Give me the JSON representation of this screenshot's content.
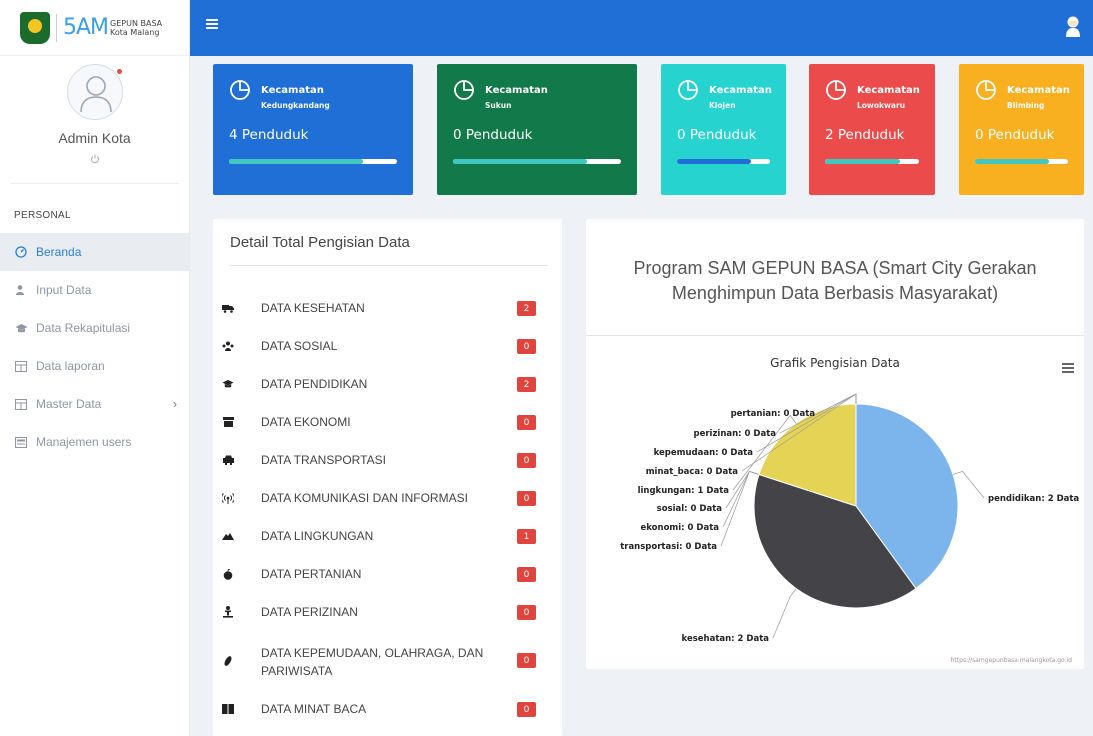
{
  "brand": {
    "logo_text": "5AM",
    "line1": "GEPUN BASA",
    "line2": "Kota Malang"
  },
  "profile": {
    "name": "Admin Kota"
  },
  "nav": {
    "heading": "PERSONAL",
    "items": [
      {
        "label": "Beranda",
        "icon": "dashboard-icon",
        "active": true
      },
      {
        "label": "Input Data",
        "icon": "user-edit-icon"
      },
      {
        "label": "Data Rekapitulasi",
        "icon": "graduation-cap-icon"
      },
      {
        "label": "Data laporan",
        "icon": "table-icon"
      },
      {
        "label": "Master Data",
        "icon": "table-icon"
      },
      {
        "label": "Manajemen users",
        "icon": "users-table-icon"
      }
    ]
  },
  "cards": [
    {
      "title": "Kecamatan",
      "sub": "Kedungkandang",
      "value": "4 Penduduk",
      "bg": "#1f6fd6",
      "fill": "#3fc7c0",
      "progress": 0.8
    },
    {
      "title": "Kecamatan",
      "sub": "Sukun",
      "value": "0 Penduduk",
      "bg": "#127a4a",
      "fill": "#3fc7c0",
      "progress": 0.8
    },
    {
      "title": "Kecamatan",
      "sub": "Klojen",
      "value": "0 Penduduk",
      "bg": "#27d3cf",
      "fill": "#1f6fd6",
      "progress": 0.8
    },
    {
      "title": "Kecamatan",
      "sub": "Lowokwaru",
      "value": "2 Penduduk",
      "bg": "#ec4b4b",
      "fill": "#3fc7c0",
      "progress": 0.8
    },
    {
      "title": "Kecamatan",
      "sub": "Blimbing",
      "value": "0 Penduduk",
      "bg": "#f8b021",
      "fill": "#3fc7c0",
      "progress": 0.8
    }
  ],
  "detail": {
    "title": "Detail Total Pengisian Data",
    "rows": [
      {
        "label": "DATA KESEHATAN",
        "count": "2",
        "icon": "ambulance-icon"
      },
      {
        "label": "DATA SOSIAL",
        "count": "0",
        "icon": "users-icon"
      },
      {
        "label": "DATA PENDIDIKAN",
        "count": "2",
        "icon": "graduation-cap-icon"
      },
      {
        "label": "DATA EKONOMI",
        "count": "0",
        "icon": "store-icon"
      },
      {
        "label": "DATA TRANSPORTASI",
        "count": "0",
        "icon": "car-icon"
      },
      {
        "label": "DATA KOMUNIKASI DAN INFORMASI",
        "count": "0",
        "icon": "broadcast-icon"
      },
      {
        "label": "DATA LINGKUNGAN",
        "count": "1",
        "icon": "mountain-icon"
      },
      {
        "label": "DATA PERTANIAN",
        "count": "0",
        "icon": "apple-icon"
      },
      {
        "label": "DATA PERIZINAN",
        "count": "0",
        "icon": "person-icon"
      },
      {
        "label": "DATA KEPEMUDAAN, OLAHRAGA, DAN PARIWISATA",
        "count": "0",
        "icon": "football-icon"
      },
      {
        "label": "DATA MINAT BACA",
        "count": "0",
        "icon": "book-icon"
      }
    ]
  },
  "chart_panel": {
    "program_title": "Program SAM GEPUN BASA (Smart City Gerakan Menghimpun Data Berbasis Masyarakat)",
    "credit": "https://samgepunbasa.malangkota.go.id"
  },
  "chart_data": {
    "type": "pie",
    "title": "Grafik Pengisian Data",
    "slices": [
      {
        "name": "pendidikan",
        "value": 2,
        "label": "pendidikan: 2 Data",
        "color": "#7cb5ec"
      },
      {
        "name": "kesehatan",
        "value": 2,
        "label": "kesehatan: 2 Data",
        "color": "#434348"
      },
      {
        "name": "transportasi",
        "value": 0,
        "label": "transportasi: 0 Data",
        "color": "#90ed7d"
      },
      {
        "name": "ekonomi",
        "value": 0,
        "label": "ekonomi: 0 Data",
        "color": "#f7a35c"
      },
      {
        "name": "sosial",
        "value": 0,
        "label": "sosial: 0 Data",
        "color": "#8085e9"
      },
      {
        "name": "lingkungan",
        "value": 1,
        "label": "lingkungan: 1 Data",
        "color": "#e4d354"
      },
      {
        "name": "minat_baca",
        "value": 0,
        "label": "minat_baca: 0 Data",
        "color": "#2b908f"
      },
      {
        "name": "kepemudaan",
        "value": 0,
        "label": "kepemudaan: 0 Data",
        "color": "#f45b5b"
      },
      {
        "name": "perizinan",
        "value": 0,
        "label": "perizinan: 0 Data",
        "color": "#91e8e1"
      },
      {
        "name": "pertanian",
        "value": 0,
        "label": "pertanian: 0 Data",
        "color": "#7cb5ec"
      }
    ]
  }
}
